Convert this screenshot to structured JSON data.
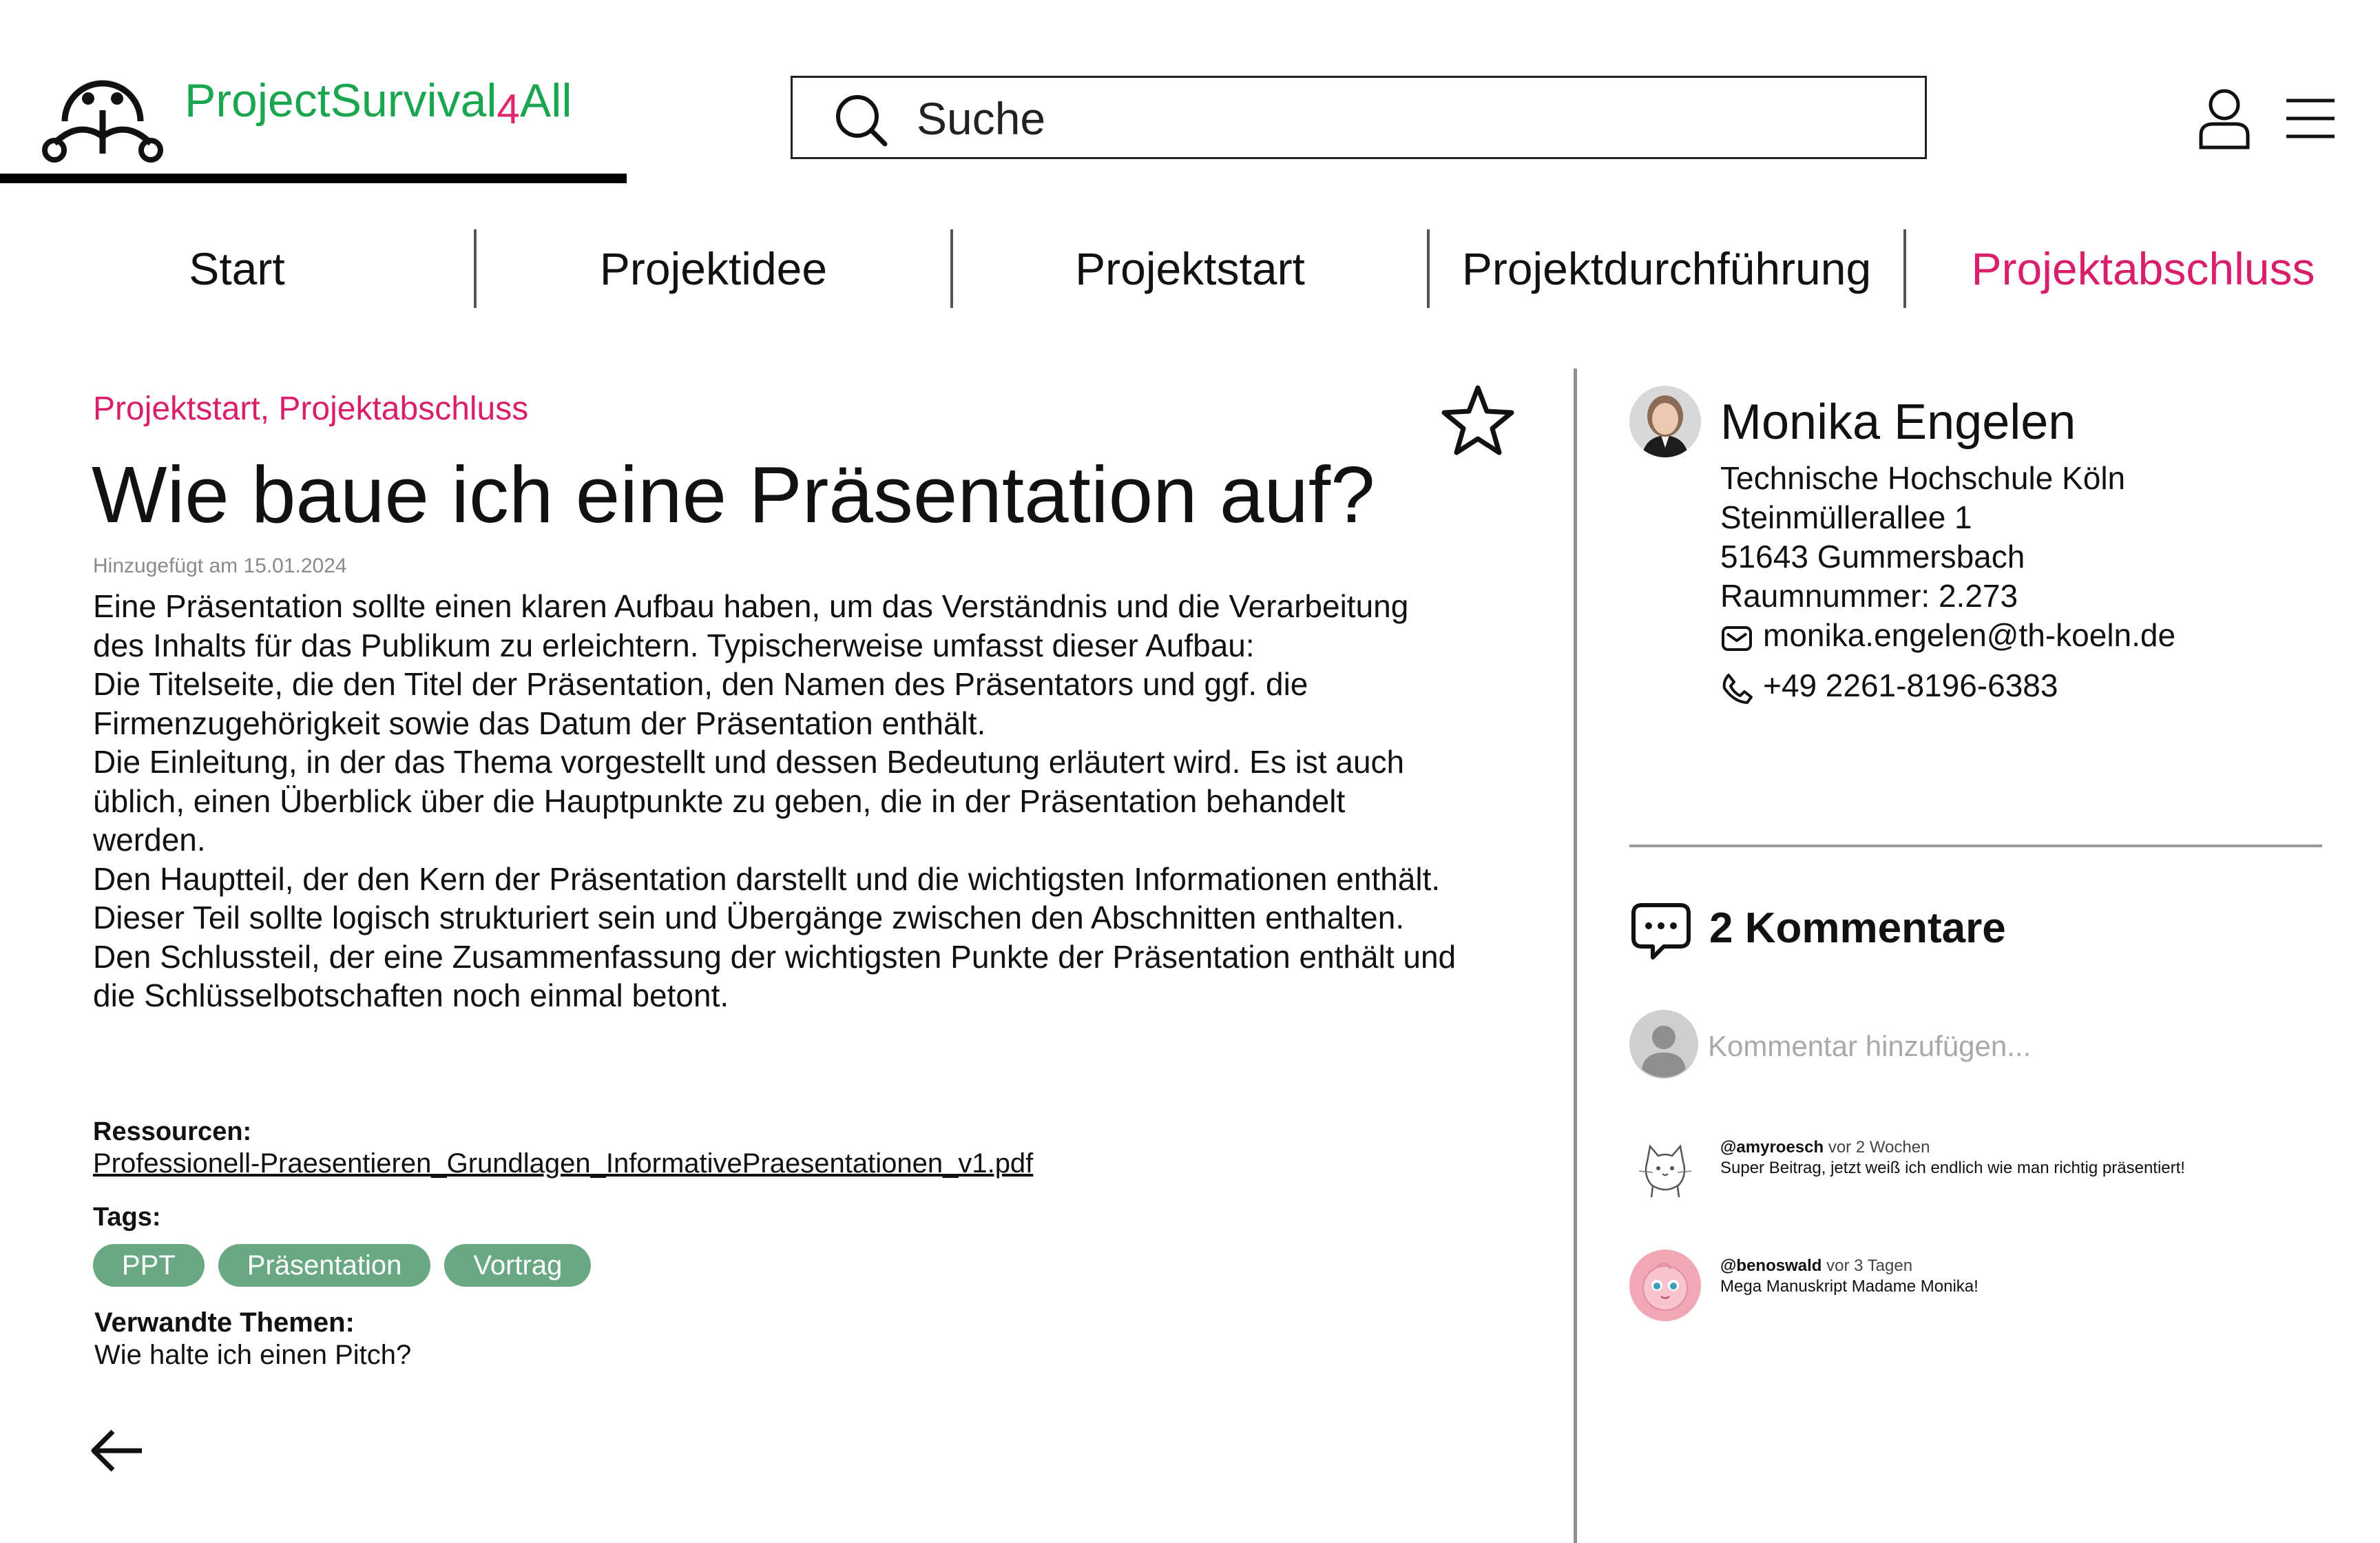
{
  "header": {
    "brand": {
      "main": "ProjectSurvival",
      "digit": "4",
      "tail": "All"
    },
    "search": {
      "placeholder": "Suche"
    },
    "icons": {
      "logo": "mascot-logo-icon",
      "search": "search-icon",
      "user": "user-icon",
      "menu": "hamburger-menu-icon"
    }
  },
  "nav": {
    "items": [
      {
        "label": "Start"
      },
      {
        "label": "Projektidee"
      },
      {
        "label": "Projektstart"
      },
      {
        "label": "Projektdurchführung"
      },
      {
        "label": "Projektabschluss"
      }
    ],
    "active_color": "#d91e6b"
  },
  "article": {
    "categories": "Projektstart, Projektabschluss",
    "title": "Wie baue ich eine Präsentation auf?",
    "added": "Hinzugefügt am 15.01.2024",
    "paragraphs": [
      "Eine Präsentation sollte einen klaren Aufbau haben, um das Verständnis und die Verarbeitung des Inhalts für das Publikum zu erleichtern. Typischerweise umfasst dieser Aufbau:",
      "Die Titelseite, die den Titel der Präsentation, den Namen des Präsentators und ggf. die Firmenzugehörigkeit sowie das Datum der Präsentation enthält.",
      "Die Einleitung, in der das Thema vorgestellt und dessen Bedeutung erläutert wird. Es ist auch üblich, einen Überblick über die Hauptpunkte zu geben, die in der Präsentation behandelt werden.",
      "Den Hauptteil, der den Kern der Präsentation darstellt und die wichtigsten Informationen enthält. Dieser Teil sollte logisch strukturiert sein und Übergänge zwischen den Abschnitten enthalten.",
      "Den Schlussteil, der eine Zusammenfassung der wichtigsten Punkte der Präsentation enthält und die Schlüsselbotschaften noch einmal betont."
    ],
    "resources_label": "Ressourcen:",
    "resource_file": "Professionell-Praesentieren_Grundlagen_InformativePraesentationen_v1.pdf",
    "tags_label": "Tags:",
    "tags": [
      "PPT",
      "Präsentation",
      "Vortrag"
    ],
    "tag_color": "#6aa883",
    "related_label": "Verwandte Themen:",
    "related": [
      "Wie halte ich einen Pitch?"
    ],
    "icons": {
      "favorite": "star-outline-icon",
      "back": "arrow-left-icon"
    }
  },
  "author": {
    "name": "Monika Engelen",
    "institution": "Technische Hochschule Köln",
    "street": "Steinmüllerallee 1",
    "city": "51643 Gummersbach",
    "room": "Raumnummer: 2.273",
    "email": "monika.engelen@th-koeln.de",
    "phone": "+49 2261-8196-6383",
    "icons": {
      "avatar": "author-photo",
      "mail": "mail-icon",
      "phone": "phone-icon"
    }
  },
  "comments": {
    "count_label": "2 Kommentare",
    "input_placeholder": "Kommentar hinzufügen...",
    "items": [
      {
        "user": "@amyroesch",
        "when": "vor 2 Wochen",
        "text": "Super Beitrag, jetzt weiß ich endlich wie man richtig präsentiert!",
        "avatar": "cat-sketch-avatar"
      },
      {
        "user": "@benoswald",
        "when": "vor 3 Tagen",
        "text": "Mega Manuskript Madame Monika!",
        "avatar": "pink-character-avatar"
      }
    ]
  }
}
